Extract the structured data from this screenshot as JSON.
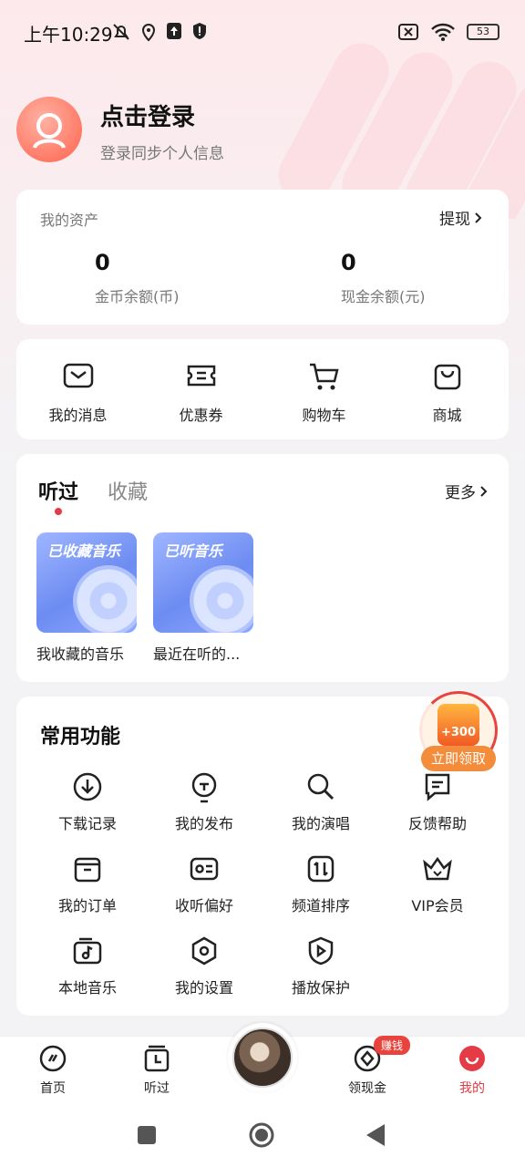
{
  "status_bar": {
    "time": "上午10:29",
    "battery": "53"
  },
  "profile": {
    "title": "点击登录",
    "subtitle": "登录同步个人信息"
  },
  "assets": {
    "label": "我的资产",
    "withdraw_label": "提现",
    "coin_value": "0",
    "coin_label": "金币余额(币)",
    "cash_value": "0",
    "cash_label": "现金余额(元)"
  },
  "quick_actions": [
    {
      "label": "我的消息",
      "icon": "message-icon"
    },
    {
      "label": "优惠券",
      "icon": "coupon-icon"
    },
    {
      "label": "购物车",
      "icon": "cart-icon"
    },
    {
      "label": "商城",
      "icon": "shop-bag-icon"
    }
  ],
  "history": {
    "tab_active": "听过",
    "tab_inactive": "收藏",
    "more_label": "更多",
    "albums": [
      {
        "cover_text": "已收藏音乐",
        "caption": "我收藏的音乐"
      },
      {
        "cover_text": "已听音乐",
        "caption": "最近在听的..."
      }
    ]
  },
  "functions": {
    "title": "常用功能",
    "items": [
      {
        "label": "下载记录",
        "icon": "download-icon"
      },
      {
        "label": "我的发布",
        "icon": "publish-icon"
      },
      {
        "label": "我的演唱",
        "icon": "microphone-icon"
      },
      {
        "label": "反馈帮助",
        "icon": "feedback-icon"
      },
      {
        "label": "我的订单",
        "icon": "order-icon"
      },
      {
        "label": "收听偏好",
        "icon": "preference-icon"
      },
      {
        "label": "频道排序",
        "icon": "sort-icon"
      },
      {
        "label": "VIP会员",
        "icon": "crown-icon"
      },
      {
        "label": "本地音乐",
        "icon": "local-music-icon"
      },
      {
        "label": "我的设置",
        "icon": "settings-icon"
      },
      {
        "label": "播放保护",
        "icon": "play-protect-icon"
      }
    ]
  },
  "reward": {
    "amount": "+300",
    "button": "立即领取"
  },
  "bottom_nav": {
    "home": "首页",
    "listened": "听过",
    "earn": "领现金",
    "earn_badge": "赚钱",
    "mine": "我的"
  },
  "colors": {
    "accent": "#e53b46",
    "reward": "#f38c3b"
  }
}
